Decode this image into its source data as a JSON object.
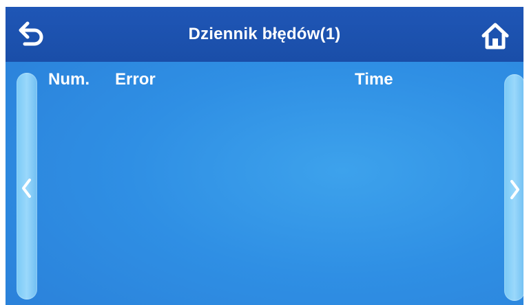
{
  "header": {
    "title": "Dziennik błędów(1)",
    "back_icon": "back-arrow-icon",
    "home_icon": "home-icon"
  },
  "table": {
    "columns": [
      "Num.",
      "Error",
      "Time"
    ],
    "rows": []
  },
  "nav": {
    "prev_icon": "chevron-left-icon",
    "next_icon": "chevron-right-icon"
  },
  "colors": {
    "header_bg": "#1f56b6",
    "screen_bg": "#2f8fe4",
    "side_button": "#8fd2f8",
    "text": "#ffffff"
  }
}
